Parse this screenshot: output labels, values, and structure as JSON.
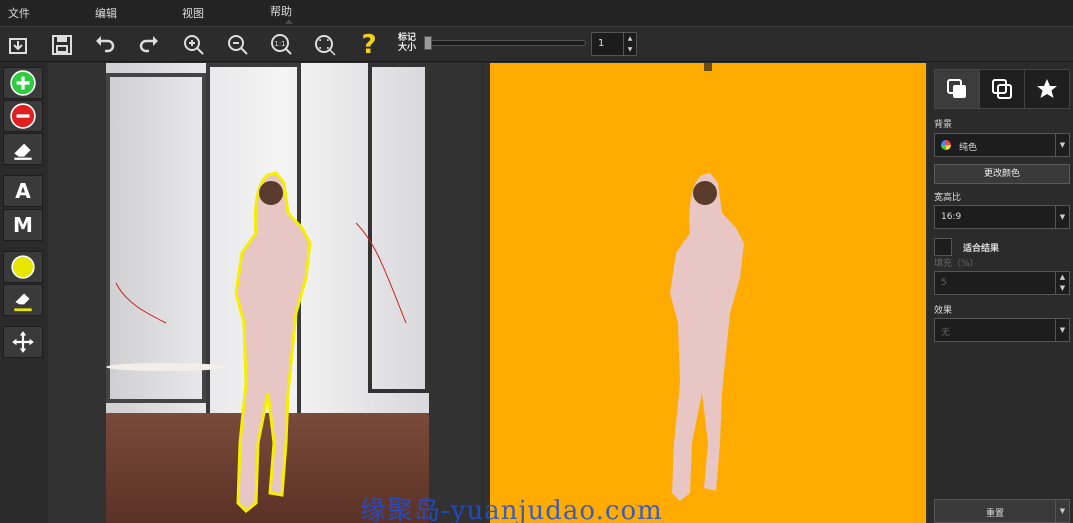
{
  "menu": {
    "file": "文件",
    "edit": "编辑",
    "view": "视图",
    "help": "帮助"
  },
  "toolbar": {
    "open_icon": "open-icon",
    "save_icon": "save-icon",
    "undo_icon": "undo-icon",
    "redo_icon": "redo-icon",
    "zoom_in_icon": "zoom-in-icon",
    "zoom_out_icon": "zoom-out-icon",
    "zoom_actual_label": "1:1",
    "zoom_fit_icon": "zoom-fit-icon",
    "help_label": "?",
    "marker_size_line1": "标记",
    "marker_size_line2": "大小",
    "marker_size_value": "1"
  },
  "left_tools": {
    "add_icon": "plus-circle-icon",
    "remove_icon": "minus-circle-icon",
    "eraser_icon": "eraser-icon",
    "auto_label": "A",
    "manual_label": "M",
    "color_icon": "color-circle-icon",
    "color_eraser_icon": "eraser-icon",
    "move_icon": "move-icon"
  },
  "right_panel": {
    "background_label": "背景",
    "background_value": "纯色",
    "change_color_button": "更改颜色",
    "aspect_label": "宽高比",
    "aspect_value": "16:9",
    "fit_result_label": "适合结果",
    "padding_label": "填充（%）",
    "padding_value": "5",
    "effect_label": "效果",
    "effect_value": "无",
    "reset_button": "重置"
  },
  "colors": {
    "result_background": "#ffab00",
    "add_green": "#2ecc40",
    "remove_red": "#e02020",
    "marker_yellow": "#e6e600"
  },
  "watermark": "缘聚岛-yuanjudao.com"
}
